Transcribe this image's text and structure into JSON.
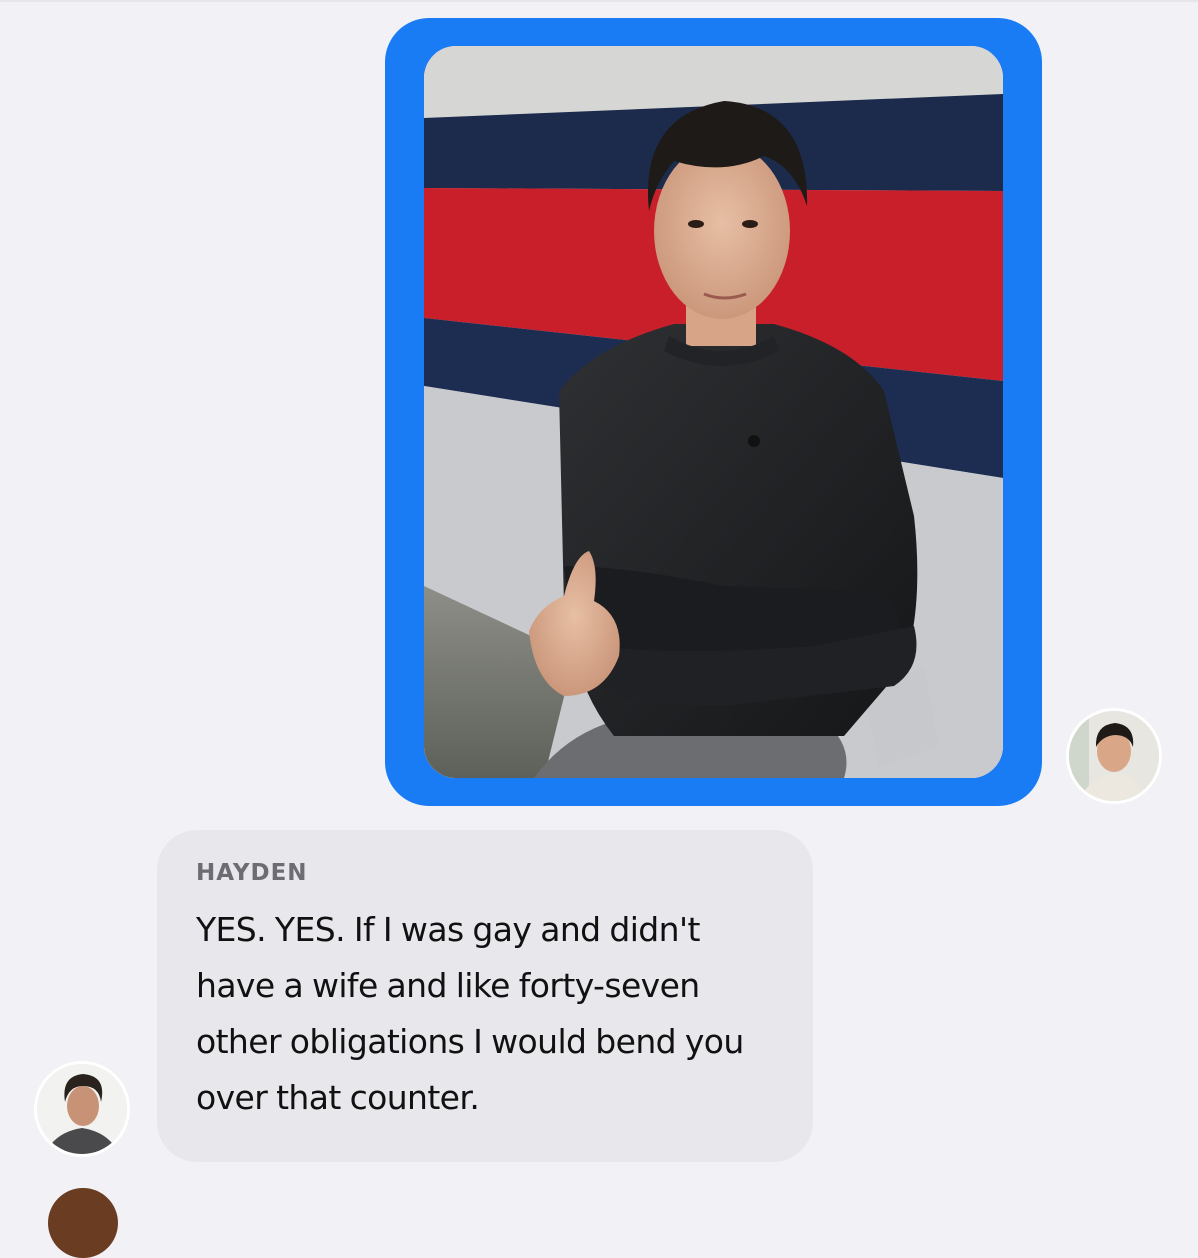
{
  "conversation": {
    "outgoing_photo": {
      "icon": "photo-attachment",
      "accent_color": "#1a7cf5"
    },
    "self_avatar": {
      "icon": "user-avatar-photo"
    },
    "incoming_message": {
      "sender": "HAYDEN",
      "text": "YES. YES. If I was gay and didn't have a wife and like forty-seven other obligations I would bend you over that counter.",
      "bubble_color": "#e7e7ec"
    },
    "sender_avatar": {
      "icon": "user-avatar-photo"
    }
  }
}
